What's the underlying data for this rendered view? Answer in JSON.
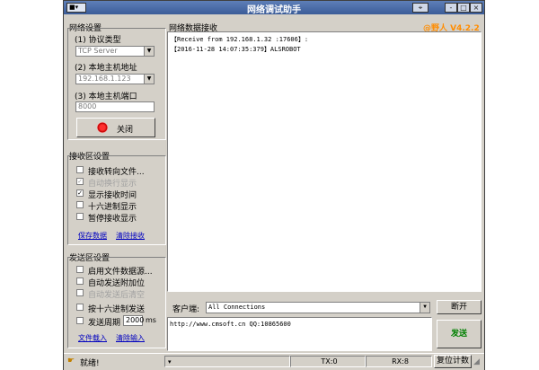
{
  "window": {
    "title": "网络调试助手",
    "minimize": "-",
    "maximize": "□",
    "close": "×",
    "version": "@野人 V4.2.2"
  },
  "network": {
    "group_title": "网络设置",
    "protocol_label": "(1) 协议类型",
    "protocol_value": "TCP Server",
    "host_label": "(2) 本地主机地址",
    "host_value": "192.168.1.123",
    "port_label": "(3) 本地主机端口",
    "port_value": "8000",
    "close_button": "关闭"
  },
  "receive_settings": {
    "group_title": "接收区设置",
    "options": [
      {
        "label": "接收转向文件...",
        "checked": false,
        "disabled": false
      },
      {
        "label": "自动换行显示",
        "checked": true,
        "disabled": true
      },
      {
        "label": "显示接收时间",
        "checked": true,
        "disabled": false
      },
      {
        "label": "十六进制显示",
        "checked": false,
        "disabled": false
      },
      {
        "label": "暂停接收显示",
        "checked": false,
        "disabled": false
      }
    ],
    "save_link": "保存数据",
    "clear_link": "清除接收"
  },
  "send_settings": {
    "group_title": "发送区设置",
    "options": [
      {
        "label": "启用文件数据源...",
        "checked": false,
        "disabled": false
      },
      {
        "label": "自动发送附加位",
        "checked": false,
        "disabled": false
      },
      {
        "label": "自动发送后清空",
        "checked": false,
        "disabled": true
      },
      {
        "label": "按十六进制发送",
        "checked": false,
        "disabled": false
      }
    ],
    "cycle_label": "发送周期",
    "cycle_value": "2000",
    "cycle_unit": "ms",
    "load_link": "文件载入",
    "clear_link": "清除输入"
  },
  "receive_area": {
    "title": "网络数据接收",
    "lines": [
      "【Receive from 192.168.1.32 :17606】:",
      "【2016-11-28 14:07:35:379】ALSROBOT"
    ]
  },
  "client_bar": {
    "label": "客户端:",
    "value": "All Connections",
    "disconnect_button": "断开"
  },
  "send_area": {
    "text": "http://www.cmsoft.cn QQ:10865600",
    "send_button": "发送"
  },
  "status": {
    "ready": "就绪!",
    "tx": "TX:0",
    "rx": "RX:8",
    "reset_button": "复位计数"
  }
}
